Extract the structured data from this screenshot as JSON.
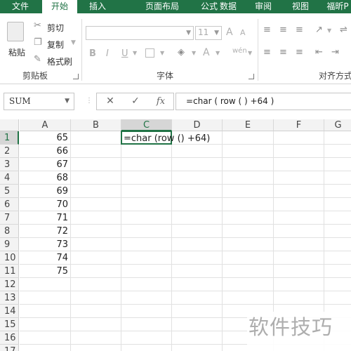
{
  "ribbon_tabs": [
    "文件",
    "开始",
    "插入",
    "页面布局",
    "公式",
    "数据",
    "审阅",
    "视图",
    "福昕P"
  ],
  "active_tab": "开始",
  "clipboard": {
    "paste": "粘贴",
    "cut": "剪切",
    "copy": "复制",
    "format_painter": "格式刷",
    "group_label": "剪贴板"
  },
  "font": {
    "font_name": "",
    "font_size": "11",
    "bold": "B",
    "italic": "I",
    "underline": "U",
    "grow": "A",
    "shrink": "A",
    "font_color": "A",
    "phonetic": "wén",
    "group_label": "字体"
  },
  "alignment": {
    "group_label": "对齐方式"
  },
  "formula_bar": {
    "name_box": "SUM",
    "cancel": "✕",
    "enter": "✓",
    "fx": "fx",
    "formula": "=char ( row ( ) +64 )"
  },
  "columns": [
    "A",
    "B",
    "C",
    "D",
    "E",
    "F",
    "G"
  ],
  "rows": [
    "1",
    "2",
    "3",
    "4",
    "5",
    "6",
    "7",
    "8",
    "9",
    "10",
    "11",
    "12",
    "13",
    "14",
    "15",
    "16",
    "17"
  ],
  "column_a_values": [
    "65",
    "66",
    "67",
    "68",
    "69",
    "70",
    "71",
    "72",
    "73",
    "74",
    "75"
  ],
  "active_cell": {
    "ref": "C1",
    "content": "=char  (row  ()  +64)"
  },
  "watermark": "软件技巧",
  "colors": {
    "accent": "#217346",
    "header_bg": "#f3f3f3",
    "grid_line": "#e1e1e1"
  }
}
